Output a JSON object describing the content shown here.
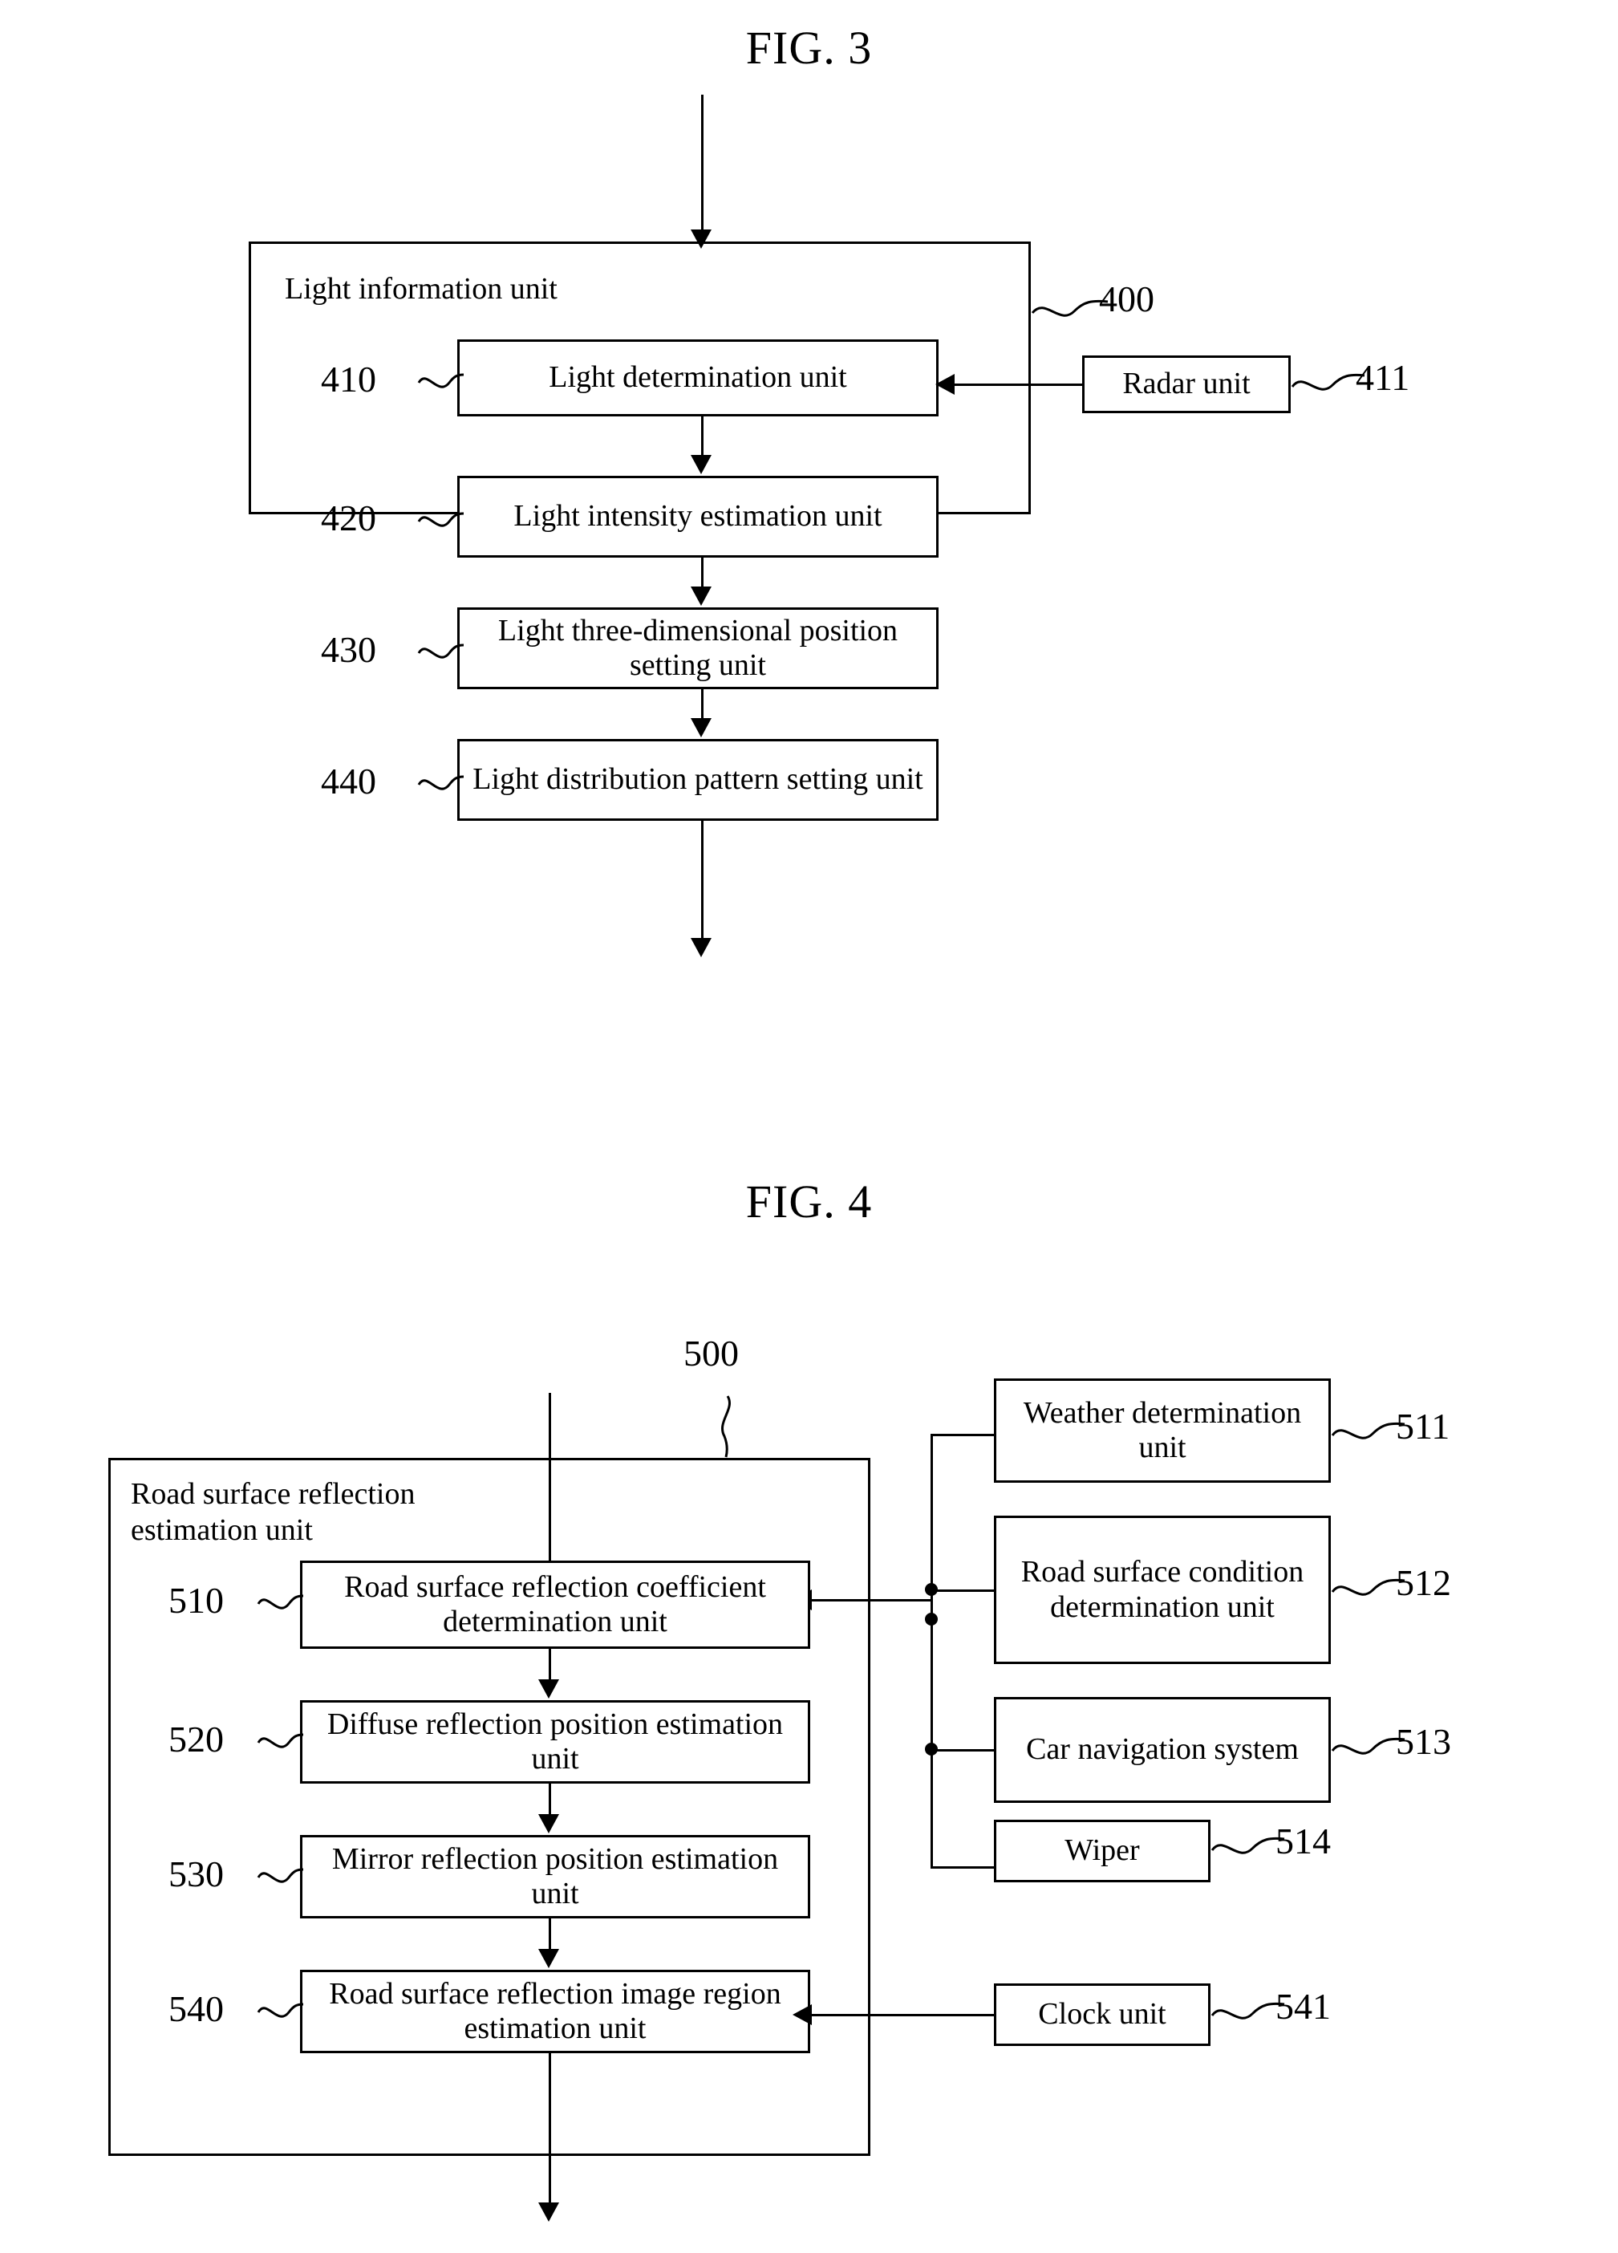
{
  "figures": [
    {
      "title": "FIG. 3",
      "container": {
        "label": "Light information unit",
        "ref": "400"
      },
      "blocks": [
        {
          "ref": "410",
          "label": "Light determination unit"
        },
        {
          "ref": "420",
          "label": "Light intensity estimation unit"
        },
        {
          "ref": "430",
          "label": "Light three-dimensional position setting unit"
        },
        {
          "ref": "440",
          "label": "Light distribution pattern setting unit"
        }
      ],
      "external_blocks": [
        {
          "ref": "411",
          "label": "Radar unit"
        }
      ]
    },
    {
      "title": "FIG. 4",
      "container": {
        "label": "Road surface reflection\nestimation unit",
        "ref": "500"
      },
      "blocks": [
        {
          "ref": "510",
          "label": "Road surface reflection coefficient determination unit"
        },
        {
          "ref": "520",
          "label": "Diffuse reflection position estimation unit"
        },
        {
          "ref": "530",
          "label": "Mirror reflection position estimation unit"
        },
        {
          "ref": "540",
          "label": "Road surface reflection image region estimation unit"
        }
      ],
      "external_blocks": [
        {
          "ref": "511",
          "label": "Weather determination unit"
        },
        {
          "ref": "512",
          "label": "Road surface condition determination unit"
        },
        {
          "ref": "513",
          "label": "Car navigation system"
        },
        {
          "ref": "514",
          "label": "Wiper"
        },
        {
          "ref": "541",
          "label": "Clock unit"
        }
      ]
    }
  ],
  "colors": {
    "ink": "#000000",
    "paper": "#ffffff"
  }
}
